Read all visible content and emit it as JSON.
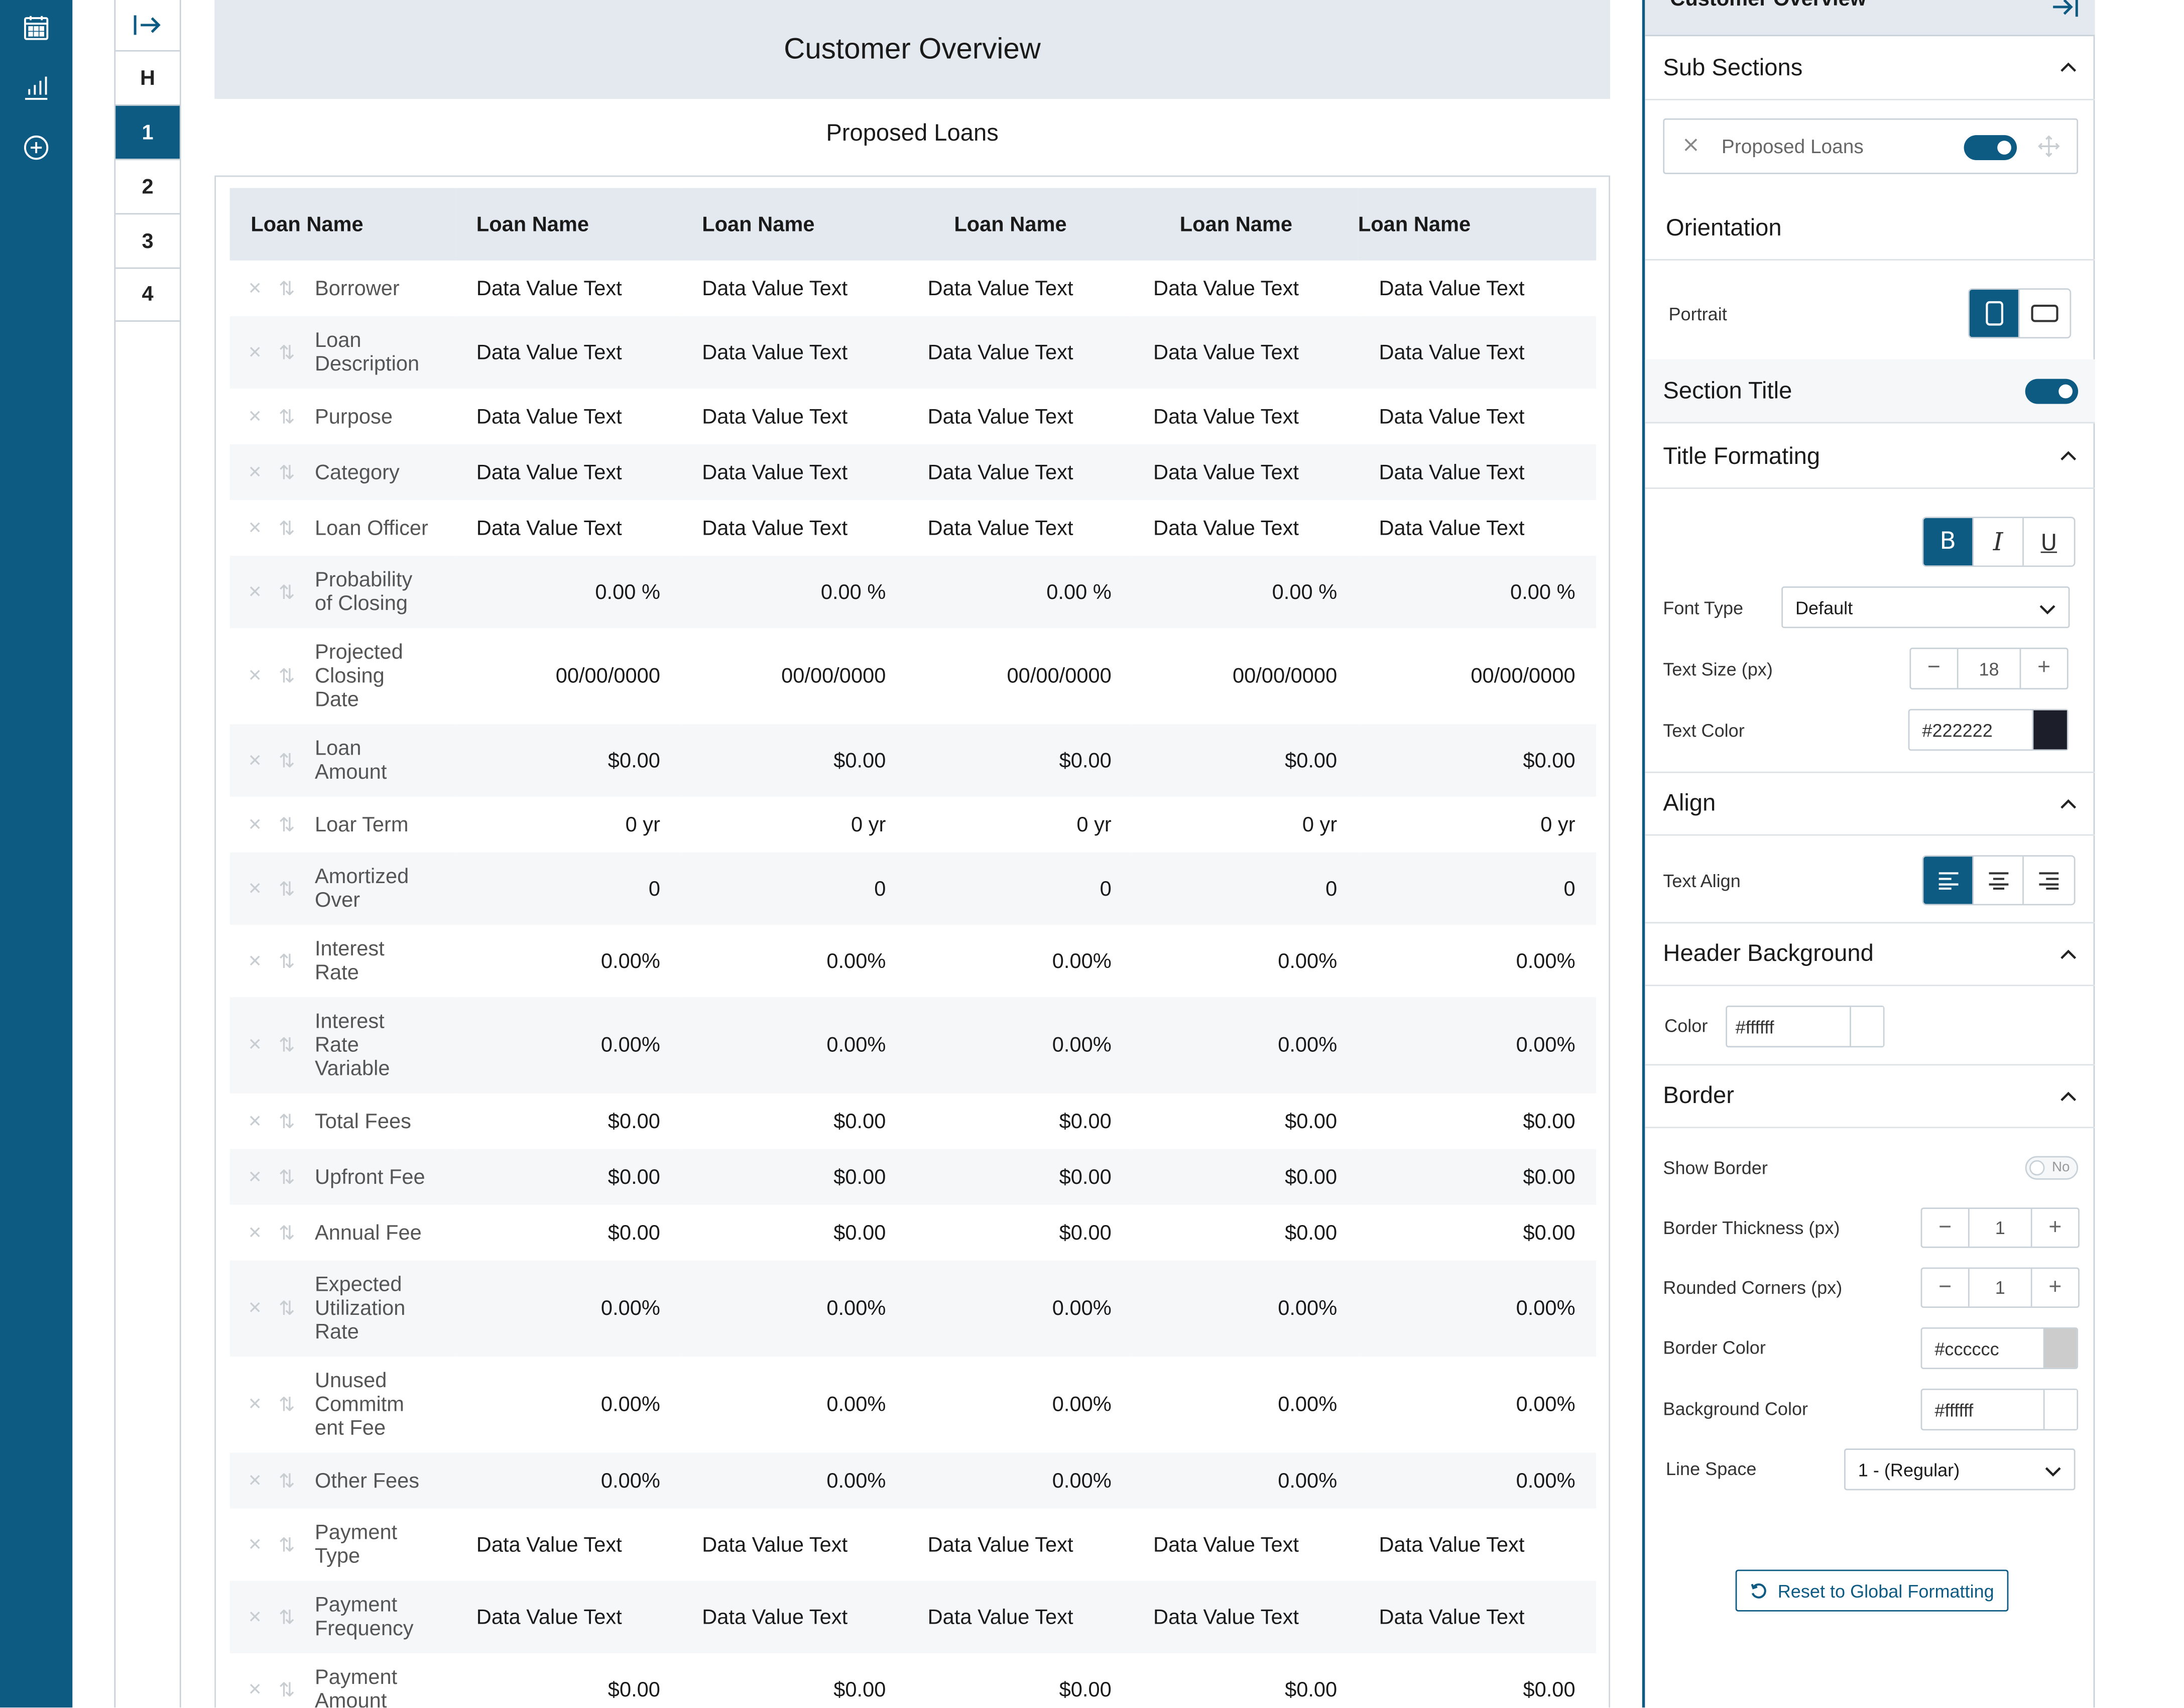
{
  "colors": {
    "brand": "#0d5a83",
    "header_band": "#e3e9ee",
    "title_text_color": "#222222"
  },
  "nav": {
    "icons": [
      "calendar-icon",
      "bar-chart-icon",
      "add-circle-icon"
    ]
  },
  "pager": {
    "pages": [
      "H",
      "1",
      "2",
      "3",
      "4"
    ],
    "active": "1"
  },
  "main": {
    "page_title": "Customer Overview",
    "section_title": "Proposed Loans",
    "table": {
      "headers": [
        "Loan Name",
        "Loan Name",
        "Loan Name",
        "Loan Name",
        "Loan Name",
        "Loan Name"
      ],
      "rows": [
        {
          "label": "Borrower",
          "type": "text",
          "values": [
            "Data Value Text",
            "Data Value Text",
            "Data Value Text",
            "Data Value Text",
            "Data Value Text"
          ]
        },
        {
          "label": "Loan Description",
          "type": "text",
          "values": [
            "Data Value Text",
            "Data Value Text",
            "Data Value Text",
            "Data Value Text",
            "Data Value Text"
          ]
        },
        {
          "label": "Purpose",
          "type": "text",
          "values": [
            "Data Value Text",
            "Data Value Text",
            "Data Value Text",
            "Data Value Text",
            "Data Value Text"
          ]
        },
        {
          "label": "Category",
          "type": "text",
          "values": [
            "Data Value Text",
            "Data Value Text",
            "Data Value Text",
            "Data Value Text",
            "Data Value Text"
          ]
        },
        {
          "label": "Loan Officer",
          "type": "text",
          "values": [
            "Data Value Text",
            "Data Value Text",
            "Data Value Text",
            "Data Value Text",
            "Data Value Text"
          ]
        },
        {
          "label": "Probability of Closing",
          "type": "num",
          "values": [
            "0.00 %",
            "0.00 %",
            "0.00 %",
            "0.00 %",
            "0.00 %"
          ]
        },
        {
          "label": "Projected Closing Date",
          "type": "num",
          "values": [
            "00/00/0000",
            "00/00/0000",
            "00/00/0000",
            "00/00/0000",
            "00/00/0000"
          ]
        },
        {
          "label": "Loan Amount",
          "type": "num",
          "values": [
            "$0.00",
            "$0.00",
            "$0.00",
            "$0.00",
            "$0.00"
          ]
        },
        {
          "label": "Loar Term",
          "type": "num",
          "values": [
            "0 yr",
            "0 yr",
            "0 yr",
            "0 yr",
            "0 yr"
          ]
        },
        {
          "label": "Amortized Over",
          "type": "num",
          "values": [
            "0",
            "0",
            "0",
            "0",
            "0"
          ]
        },
        {
          "label": "Interest Rate",
          "type": "num",
          "values": [
            "0.00%",
            "0.00%",
            "0.00%",
            "0.00%",
            "0.00%"
          ]
        },
        {
          "label": "Interest Rate Variable",
          "type": "num",
          "values": [
            "0.00%",
            "0.00%",
            "0.00%",
            "0.00%",
            "0.00%"
          ]
        },
        {
          "label": "Total Fees",
          "type": "num",
          "values": [
            "$0.00",
            "$0.00",
            "$0.00",
            "$0.00",
            "$0.00"
          ]
        },
        {
          "label": "Upfront Fee",
          "type": "num",
          "values": [
            "$0.00",
            "$0.00",
            "$0.00",
            "$0.00",
            "$0.00"
          ]
        },
        {
          "label": "Annual Fee",
          "type": "num",
          "values": [
            "$0.00",
            "$0.00",
            "$0.00",
            "$0.00",
            "$0.00"
          ]
        },
        {
          "label": "Expected Utilization Rate",
          "type": "num",
          "values": [
            "0.00%",
            "0.00%",
            "0.00%",
            "0.00%",
            "0.00%"
          ]
        },
        {
          "label": "Unused Commitm ent Fee",
          "type": "num",
          "values": [
            "0.00%",
            "0.00%",
            "0.00%",
            "0.00%",
            "0.00%"
          ]
        },
        {
          "label": "Other Fees",
          "type": "num",
          "values": [
            "0.00%",
            "0.00%",
            "0.00%",
            "0.00%",
            "0.00%"
          ]
        },
        {
          "label": "Payment Type",
          "type": "text",
          "values": [
            "Data Value Text",
            "Data Value Text",
            "Data Value Text",
            "Data Value Text",
            "Data Value Text"
          ]
        },
        {
          "label": "Payment Frequency",
          "type": "text",
          "values": [
            "Data Value Text",
            "Data Value Text",
            "Data Value Text",
            "Data Value Text",
            "Data Value Text"
          ]
        },
        {
          "label": "Payment Amount",
          "type": "num",
          "values": [
            "$0.00",
            "$0.00",
            "$0.00",
            "$0.00",
            "$0.00"
          ]
        }
      ]
    }
  },
  "panel": {
    "top_title": "Customer Overview",
    "sub_sections": {
      "heading": "Sub Sections",
      "item_label": "Proposed Loans",
      "item_enabled": true
    },
    "orientation": {
      "heading": "Orientation",
      "label": "Portrait",
      "selected": "portrait"
    },
    "section_title": {
      "heading": "Section Title",
      "enabled": true
    },
    "title_formatting": {
      "heading": "Title Formating",
      "bold": true,
      "italic": false,
      "underline": false,
      "font_type_label": "Font Type",
      "font_type_value": "Default",
      "text_size_label": "Text Size (px)",
      "text_size_value": "18",
      "text_color_label": "Text Color",
      "text_color_value": "#222222",
      "text_color_swatch": "#1c1f2a"
    },
    "align": {
      "heading": "Align",
      "label": "Text Align",
      "selected": "left"
    },
    "header_background": {
      "heading": "Header Background",
      "label": "Color",
      "value": "#ffffff"
    },
    "border": {
      "heading": "Border",
      "show_border_label": "Show Border",
      "show_border_value": "No",
      "thickness_label": "Border Thickness (px)",
      "thickness_value": "1",
      "rounded_label": "Rounded Corners (px)",
      "rounded_value": "1",
      "border_color_label": "Border Color",
      "border_color_value": "#cccccc",
      "bg_color_label": "Background Color",
      "bg_color_value": "#ffffff",
      "line_space_label": "Line Space",
      "line_space_value": "1 - (Regular)"
    },
    "reset_label": "Reset to Global Formatting"
  }
}
